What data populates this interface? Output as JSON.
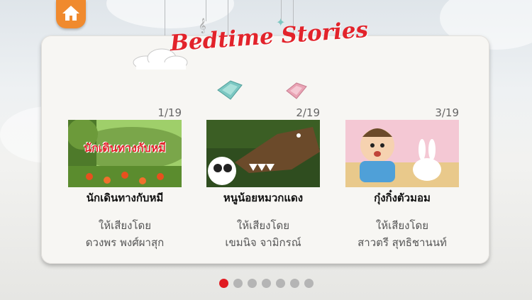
{
  "header": {
    "title": "Bedtime Stories",
    "home_icon": "home-icon"
  },
  "colors": {
    "accent": "#e11b22",
    "home_button": "#f08a2e",
    "dot_inactive": "#b5b5b5"
  },
  "stories": [
    {
      "count": "1/19",
      "thumb_caption": "นักเดินทางกับหมี",
      "name": "นักเดินทางกับหมี",
      "voice_label": "ให้เสียงโดย",
      "narrator": "ดวงพร พงศ์ผาสุก"
    },
    {
      "count": "2/19",
      "name": "หนูน้อยหมวกแดง",
      "voice_label": "ให้เสียงโดย",
      "narrator": "เขมนิจ จามิกรณ์"
    },
    {
      "count": "3/19",
      "name": "กุ๋งกิ๋งตัวมอม",
      "voice_label": "ให้เสียงโดย",
      "narrator": "สาวตรี สุทธิชานนท์"
    }
  ],
  "pagination": {
    "total": 7,
    "current": 1
  }
}
